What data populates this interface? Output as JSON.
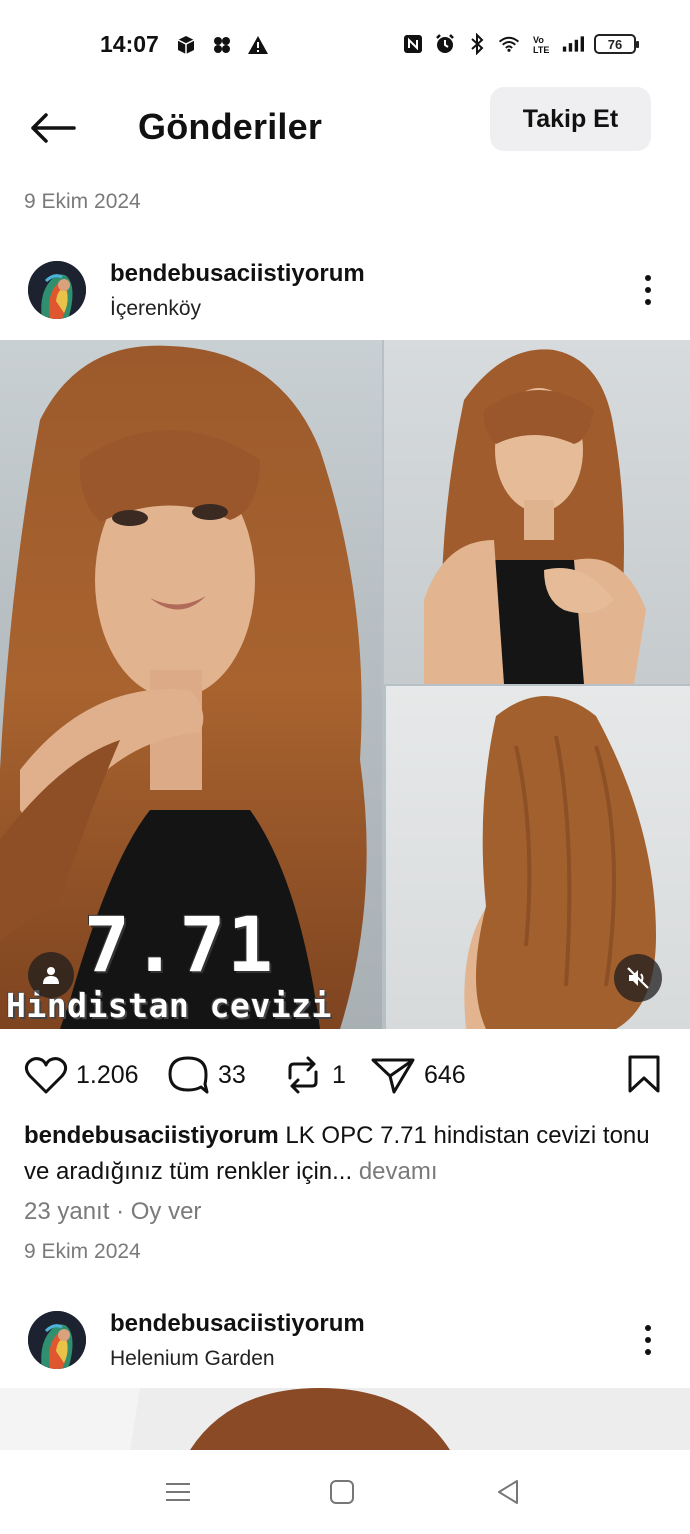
{
  "status_bar": {
    "time": "14:07",
    "battery": "76"
  },
  "header": {
    "title": "Gönderiler",
    "follow_label": "Takip Et"
  },
  "top_date": "9 Ekim 2024",
  "posts": [
    {
      "username": "bendebusaciistiyorum",
      "location": "İçerenköy",
      "media_overlay_number": "7.71",
      "media_overlay_label": "Hindistan cevizi",
      "likes": "1.206",
      "comments": "33",
      "reposts": "1",
      "shares": "646",
      "caption_user": "bendebusaciistiyorum",
      "caption_text": "LK OPC 7.71 hindistan cevizi tonu ve aradığınız tüm renkler için...",
      "caption_more": "devamı",
      "replies": "23 yanıt",
      "separator": "·",
      "vote": "Oy ver",
      "date": "9 Ekim 2024"
    },
    {
      "username": "bendebusaciistiyorum",
      "location": "Helenium Garden"
    }
  ],
  "colors": {
    "text": "#111111",
    "muted": "#7a7a7a",
    "button_bg": "#efeff1",
    "hair": "#a0582a"
  }
}
